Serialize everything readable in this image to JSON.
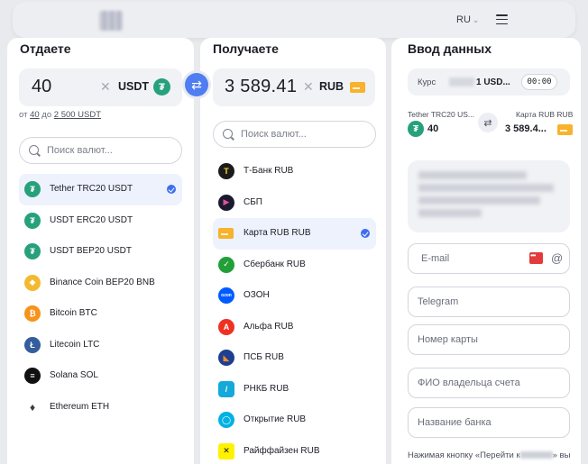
{
  "header": {
    "language": "RU"
  },
  "give": {
    "title": "Отдаете",
    "amount": "40",
    "currency": "USDT",
    "limits_from_label": "от",
    "limits_min": "40",
    "limits_to_label": "до",
    "limits_max": "2 500 USDT",
    "search_placeholder": "Поиск валют...",
    "items": [
      {
        "label": "Tether TRC20 USDT",
        "icon": "tether-icon",
        "color": "#26a17b",
        "selected": true
      },
      {
        "label": "USDT ERC20 USDT",
        "icon": "tether-icon",
        "color": "#26a17b",
        "selected": false
      },
      {
        "label": "USDT BEP20 USDT",
        "icon": "tether-icon",
        "color": "#26a17b",
        "selected": false
      },
      {
        "label": "Binance Coin BEP20 BNB",
        "icon": "binance-icon",
        "color": "#f3ba2f",
        "selected": false
      },
      {
        "label": "Bitcoin BTC",
        "icon": "bitcoin-icon",
        "color": "#f7931a",
        "selected": false
      },
      {
        "label": "Litecoin LTC",
        "icon": "litecoin-icon",
        "color": "#345d9d",
        "selected": false
      },
      {
        "label": "Solana SOL",
        "icon": "solana-icon",
        "color": "#111111",
        "selected": false
      },
      {
        "label": "Ethereum ETH",
        "icon": "ethereum-icon",
        "color": "#ffffff",
        "selected": false
      }
    ]
  },
  "get": {
    "title": "Получаете",
    "amount": "3 589.41",
    "currency": "RUB",
    "search_placeholder": "Поиск валют...",
    "items": [
      {
        "label": "Т-Банк RUB",
        "icon": "tbank-icon",
        "color": "#1b1b1b",
        "selected": false
      },
      {
        "label": "СБП",
        "icon": "sbp-icon",
        "color": "#1a1a2e",
        "selected": false
      },
      {
        "label": "Карта RUB RUB",
        "icon": "card-icon",
        "color": "#f7b22e",
        "selected": true
      },
      {
        "label": "Сбербанк RUB",
        "icon": "sberbank-icon",
        "color": "#21a038",
        "selected": false
      },
      {
        "label": "ОЗОН",
        "icon": "ozon-icon",
        "color": "#005bff",
        "selected": false
      },
      {
        "label": "Альфа RUB",
        "icon": "alfa-icon",
        "color": "#ef3124",
        "selected": false
      },
      {
        "label": "ПСБ RUB",
        "icon": "psb-icon",
        "color": "#1e3f8f",
        "selected": false
      },
      {
        "label": "РНКБ RUB",
        "icon": "rnkb-icon",
        "color": "#14a9d9",
        "selected": false
      },
      {
        "label": "Открытие RUB",
        "icon": "otkritie-icon",
        "color": "#00b1e3",
        "selected": false
      },
      {
        "label": "Райффайзен RUB",
        "icon": "raiffeisen-icon",
        "color": "#fff200",
        "selected": false
      }
    ]
  },
  "form": {
    "title": "Ввод данных",
    "rate_label": "Курс",
    "rate_value": "1 USD...",
    "timer": "00:00",
    "pair_left_name": "Tether TRC20 US...",
    "pair_left_value": "40",
    "pair_right_name": "Карта RUB RUB",
    "pair_right_value": "3 589.4...",
    "fields": {
      "email": "E-mail",
      "telegram": "Telegram",
      "card": "Номер карты",
      "owner": "ФИО владельца счета",
      "bank": "Название банка"
    },
    "footer_prefix": "Нажимая кнопку «Перейти к",
    "footer_suffix": "» вы"
  }
}
